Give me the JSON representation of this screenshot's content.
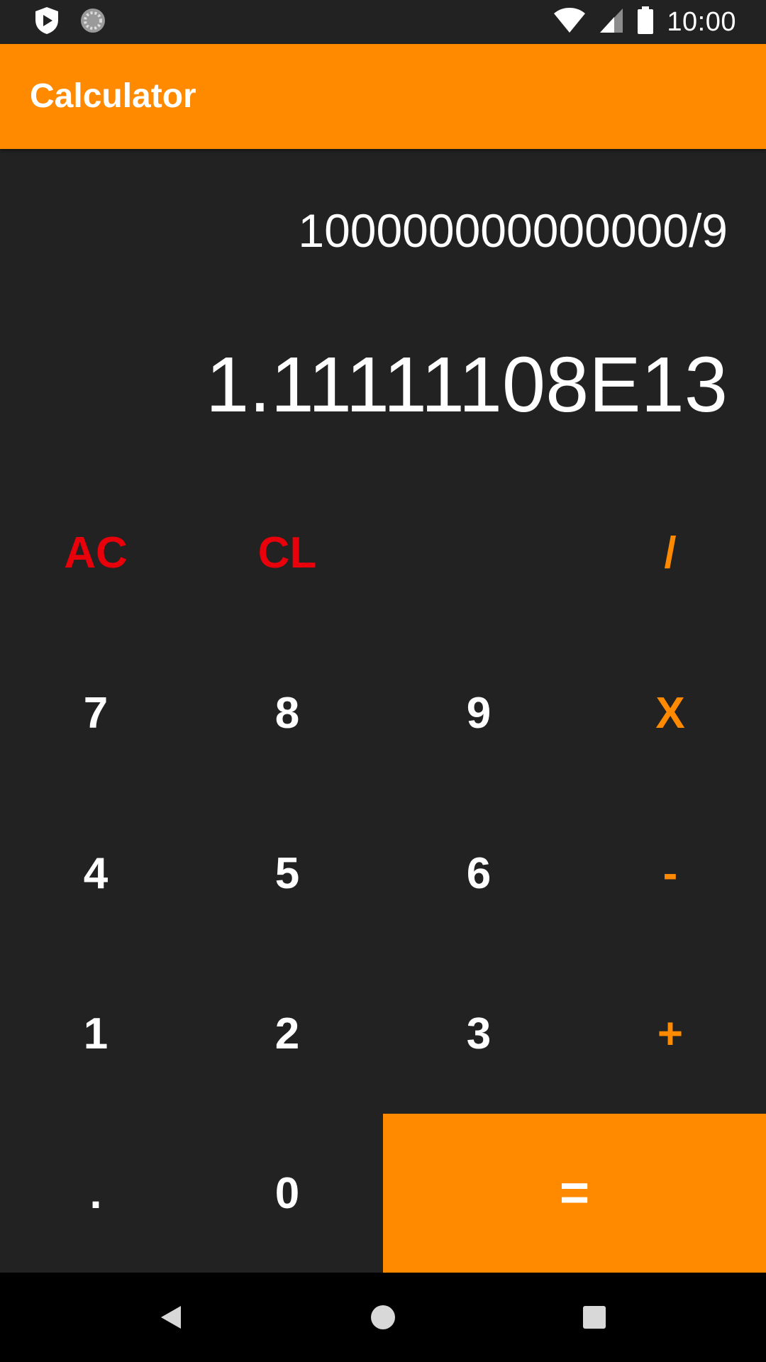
{
  "status_bar": {
    "time": "10:00",
    "icons": [
      "shield-play-icon",
      "sync-circle-icon",
      "wifi-icon",
      "cellular-signal-icon",
      "battery-icon"
    ]
  },
  "app_bar": {
    "title": "Calculator",
    "color": "#ff8a00"
  },
  "display": {
    "expression": "100000000000000/9",
    "result": "1.11111108E13"
  },
  "keypad": {
    "ac": "AC",
    "cl": "CL",
    "divide": "/",
    "seven": "7",
    "eight": "8",
    "nine": "9",
    "multiply": "X",
    "four": "4",
    "five": "5",
    "six": "6",
    "minus": "-",
    "one": "1",
    "two": "2",
    "three": "3",
    "plus": "+",
    "dot": ".",
    "zero": "0",
    "equals": "="
  },
  "colors": {
    "background": "#222222",
    "accent": "#ff8a00",
    "clear_keys": "#e8000b",
    "digits": "#ffffff"
  },
  "nav_bar": {
    "icons": [
      "back-icon",
      "home-icon",
      "recents-icon"
    ]
  }
}
